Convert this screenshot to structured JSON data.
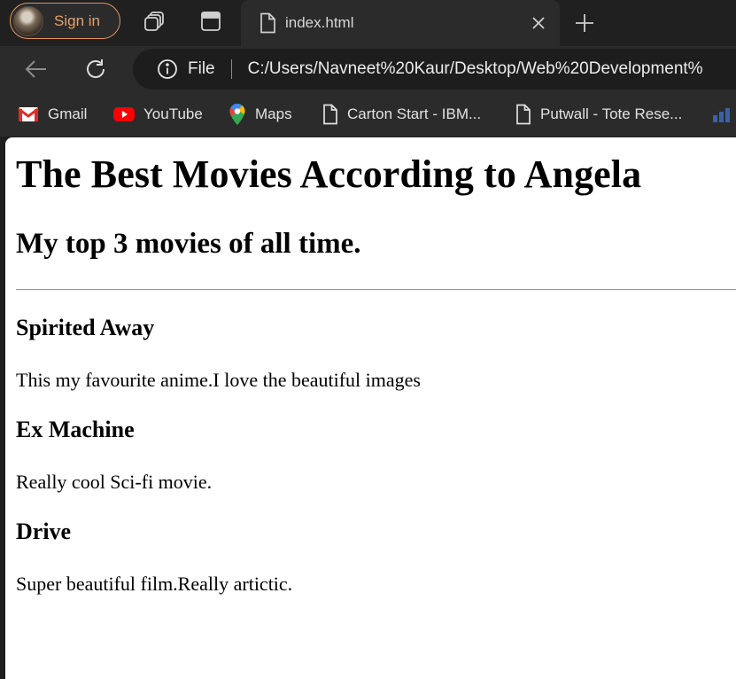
{
  "browser": {
    "profile_label": "Sign in",
    "tab": {
      "title": "index.html"
    },
    "address": {
      "scheme_label": "File",
      "url": "C:/Users/Navneet%20Kaur/Desktop/Web%20Development%"
    },
    "bookmarks": [
      {
        "label": "Gmail",
        "icon": "gmail-icon"
      },
      {
        "label": "YouTube",
        "icon": "youtube-icon"
      },
      {
        "label": "Maps",
        "icon": "maps-icon"
      },
      {
        "label": "Carton Start - IBM...",
        "icon": "page-icon"
      },
      {
        "label": "Putwall - Tote Rese...",
        "icon": "page-icon"
      }
    ]
  },
  "page": {
    "title": "The Best Movies According to Angela",
    "subtitle": "My top 3 movies of all time.",
    "movies": [
      {
        "title": "Spirited Away",
        "description": "This my favourite anime.I love the beautiful images"
      },
      {
        "title": "Ex Machine",
        "description": "Really cool Sci-fi movie."
      },
      {
        "title": "Drive",
        "description": "Super beautiful film.Really artictic."
      }
    ]
  },
  "colors": {
    "profile_accent": "#e6a06a",
    "frame": "#202020",
    "toolbar": "#2b2b2b",
    "page_background": "#ffffff"
  }
}
